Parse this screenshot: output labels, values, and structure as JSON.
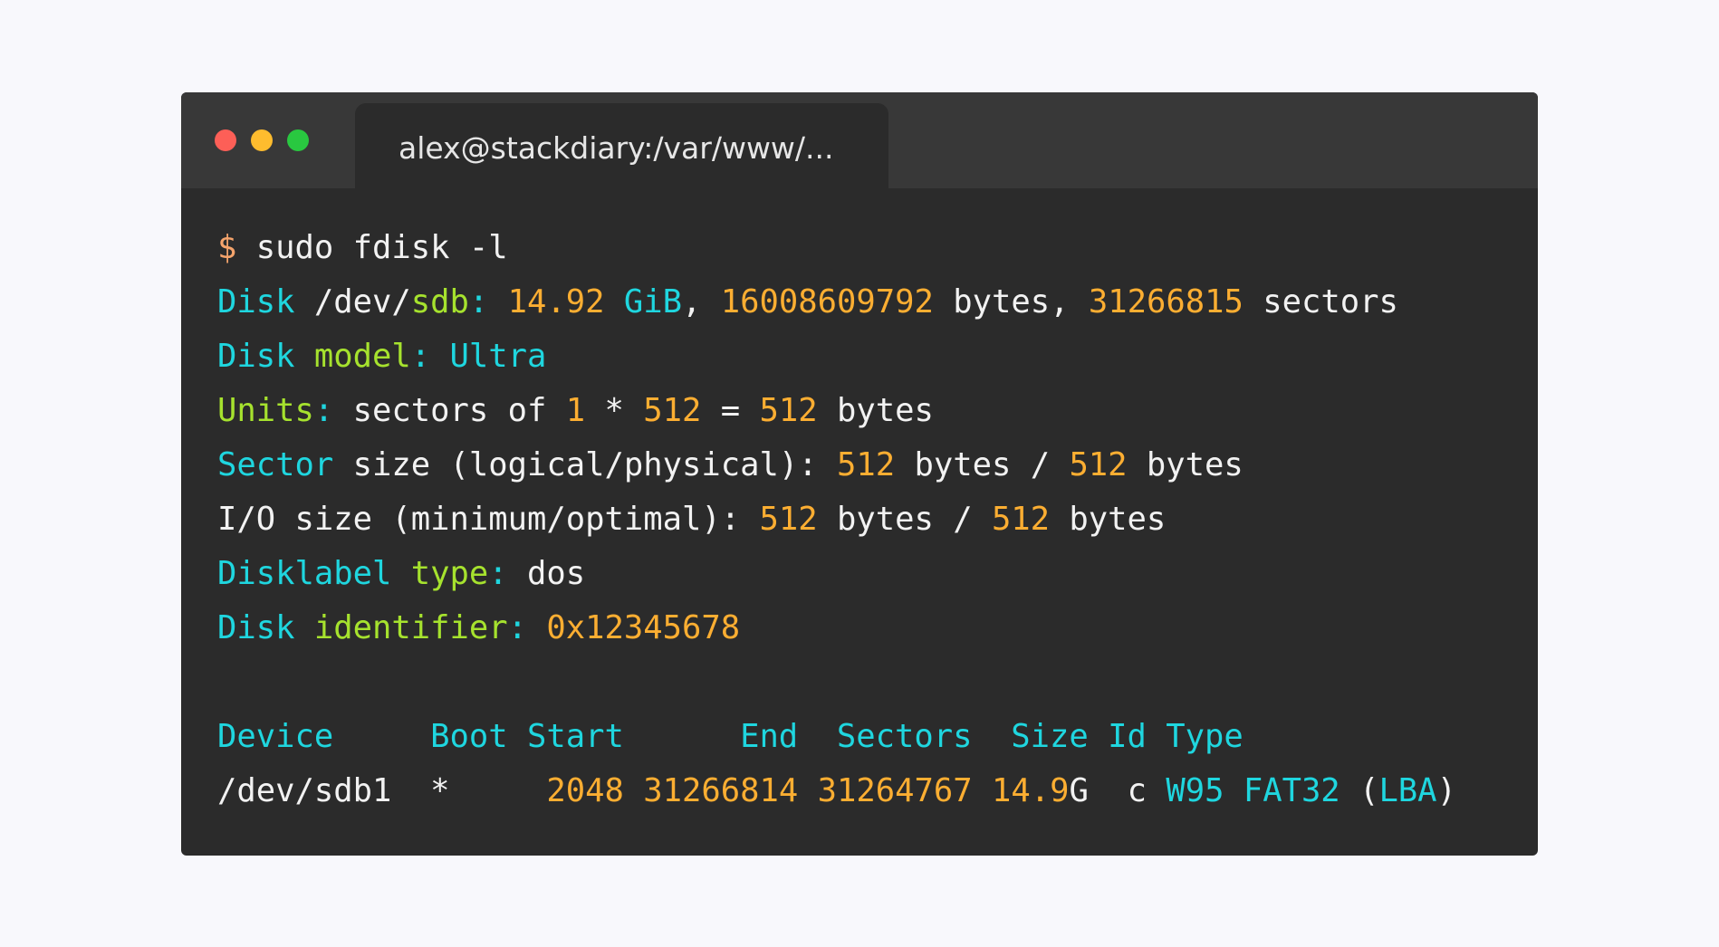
{
  "window": {
    "tab_title": "alex@stackdiary:/var/www/...",
    "controls": {
      "close": "red-dot",
      "minimize": "yellow-dot",
      "maximize": "green-dot"
    }
  },
  "colors": {
    "background": "#f8f8fc",
    "terminal_bg": "#2b2b2b",
    "titlebar_bg": "#383838",
    "cyan": "#1fd6df",
    "green": "#a6e22e",
    "orange": "#fcae32",
    "prompt": "#f5a46c",
    "white": "#f2f2f2"
  },
  "terminal": {
    "lines": [
      [
        {
          "t": "$ ",
          "c": "prompt"
        },
        {
          "t": "sudo fdisk -l",
          "c": "white"
        }
      ],
      [
        {
          "t": "Disk ",
          "c": "cyan"
        },
        {
          "t": "/dev/",
          "c": "white"
        },
        {
          "t": "sdb",
          "c": "green"
        },
        {
          "t": ": ",
          "c": "cyan"
        },
        {
          "t": "14.92",
          "c": "orange"
        },
        {
          "t": " GiB",
          "c": "cyan"
        },
        {
          "t": ", ",
          "c": "white"
        },
        {
          "t": "16008609792",
          "c": "orange"
        },
        {
          "t": " bytes, ",
          "c": "white"
        },
        {
          "t": "31266815",
          "c": "orange"
        },
        {
          "t": " sectors",
          "c": "white"
        }
      ],
      [
        {
          "t": "Disk ",
          "c": "cyan"
        },
        {
          "t": "model",
          "c": "green"
        },
        {
          "t": ": Ultra",
          "c": "cyan"
        }
      ],
      [
        {
          "t": "Units",
          "c": "green"
        },
        {
          "t": ": ",
          "c": "cyan"
        },
        {
          "t": "sectors of ",
          "c": "white"
        },
        {
          "t": "1",
          "c": "orange"
        },
        {
          "t": " * ",
          "c": "white"
        },
        {
          "t": "512",
          "c": "orange"
        },
        {
          "t": " = ",
          "c": "white"
        },
        {
          "t": "512",
          "c": "orange"
        },
        {
          "t": " bytes",
          "c": "white"
        }
      ],
      [
        {
          "t": "Sector",
          "c": "cyan"
        },
        {
          "t": " size (logical/physical): ",
          "c": "white"
        },
        {
          "t": "512",
          "c": "orange"
        },
        {
          "t": " bytes / ",
          "c": "white"
        },
        {
          "t": "512",
          "c": "orange"
        },
        {
          "t": " bytes",
          "c": "white"
        }
      ],
      [
        {
          "t": "I/O size (minimum/optimal): ",
          "c": "white"
        },
        {
          "t": "512",
          "c": "orange"
        },
        {
          "t": " bytes / ",
          "c": "white"
        },
        {
          "t": "512",
          "c": "orange"
        },
        {
          "t": " bytes",
          "c": "white"
        }
      ],
      [
        {
          "t": "Disklabel ",
          "c": "cyan"
        },
        {
          "t": "type",
          "c": "green"
        },
        {
          "t": ": ",
          "c": "cyan"
        },
        {
          "t": "dos",
          "c": "white"
        }
      ],
      [
        {
          "t": "Disk ",
          "c": "cyan"
        },
        {
          "t": "identifier",
          "c": "green"
        },
        {
          "t": ": ",
          "c": "cyan"
        },
        {
          "t": "0x12345678",
          "c": "orange"
        }
      ],
      [],
      [
        {
          "t": "Device     Boot Start      End  Sectors  Size Id Type",
          "c": "cyan"
        }
      ],
      [
        {
          "t": "/dev/sdb1  ",
          "c": "white"
        },
        {
          "t": "*",
          "c": "white"
        },
        {
          "t": "     ",
          "c": "white"
        },
        {
          "t": "2048",
          "c": "orange"
        },
        {
          "t": " ",
          "c": "white"
        },
        {
          "t": "31266814",
          "c": "orange"
        },
        {
          "t": " ",
          "c": "white"
        },
        {
          "t": "31264767",
          "c": "orange"
        },
        {
          "t": " ",
          "c": "white"
        },
        {
          "t": "14.9",
          "c": "orange"
        },
        {
          "t": "G  c ",
          "c": "white"
        },
        {
          "t": "W95 FAT32",
          "c": "cyan"
        },
        {
          "t": " (",
          "c": "white"
        },
        {
          "t": "LBA",
          "c": "cyan"
        },
        {
          "t": ")",
          "c": "white"
        }
      ]
    ]
  }
}
